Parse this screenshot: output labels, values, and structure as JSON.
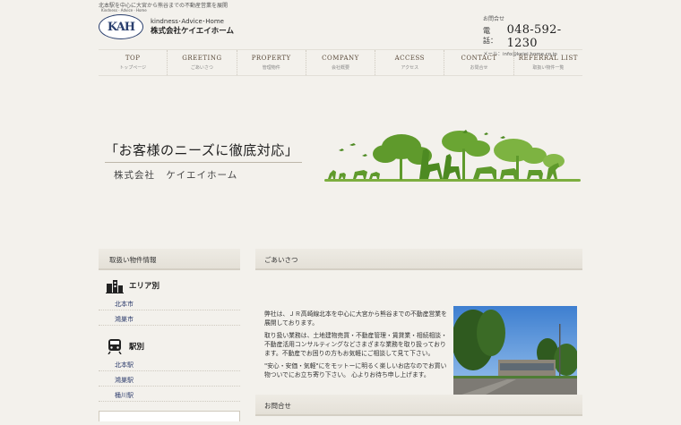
{
  "header": {
    "tagline": "北本駅を中心に大宮から熊谷までの不動産営業を展開",
    "logo": {
      "badge_text": "KAH",
      "badge_small": "Kindness · Advice · Home",
      "line1": "kindness･Advice･Home",
      "line2": "株式会社ケイエイホーム"
    },
    "contact": {
      "label": "お問合せ",
      "phone_prefix": "電話：",
      "phone": "048-592-1230",
      "mail": "メール：info@keiei home.co.jp"
    }
  },
  "nav": [
    {
      "en": "TOP",
      "jp": "トップページ"
    },
    {
      "en": "GREETING",
      "jp": "ごあいさつ"
    },
    {
      "en": "PROPERTY",
      "jp": "管理物件"
    },
    {
      "en": "COMPANY",
      "jp": "会社概要"
    },
    {
      "en": "ACCESS",
      "jp": "アクセス"
    },
    {
      "en": "CONTACT",
      "jp": "お問合せ"
    },
    {
      "en": "REFERRAL LIST",
      "jp": "取扱い物件一覧"
    }
  ],
  "hero": {
    "headline": "「お客様のニーズに徹底対応」",
    "company": "株式会社 ケイエイホーム"
  },
  "sidebar": {
    "title": "取扱い物件情報",
    "area": {
      "title": "エリア別",
      "items": [
        "北本市",
        "鴻巣市"
      ]
    },
    "station": {
      "title": "駅別",
      "items": [
        "北本駅",
        "鴻巣駅",
        "桶川駅"
      ]
    }
  },
  "main": {
    "greeting_title": "ごあいさつ",
    "paragraphs": [
      "弊社は、ＪＲ高崎線北本を中心に大宮から熊谷までの不動産営業を展開しております。",
      "取り扱い業務は、土地建物売買・不動産管理・賃貸業・相続相談・不動産活用コンサルティングなどさまざまな業務を取り扱っております。不動産でお困りの方もお気軽にご相談して見て下さい。",
      "\"安心・安価・気軽\"にをモットーに明るく楽しいお店なのでお買い物ついでにお立ち寄り下さい。 心よりお待ち申し上げます。"
    ],
    "contact_title": "お問合せ"
  },
  "colors": {
    "background": "#f3f1ec",
    "logo_blue": "#2a3f6e",
    "link_blue": "#2b3a6b",
    "hero_green": "#5f9a2c"
  }
}
